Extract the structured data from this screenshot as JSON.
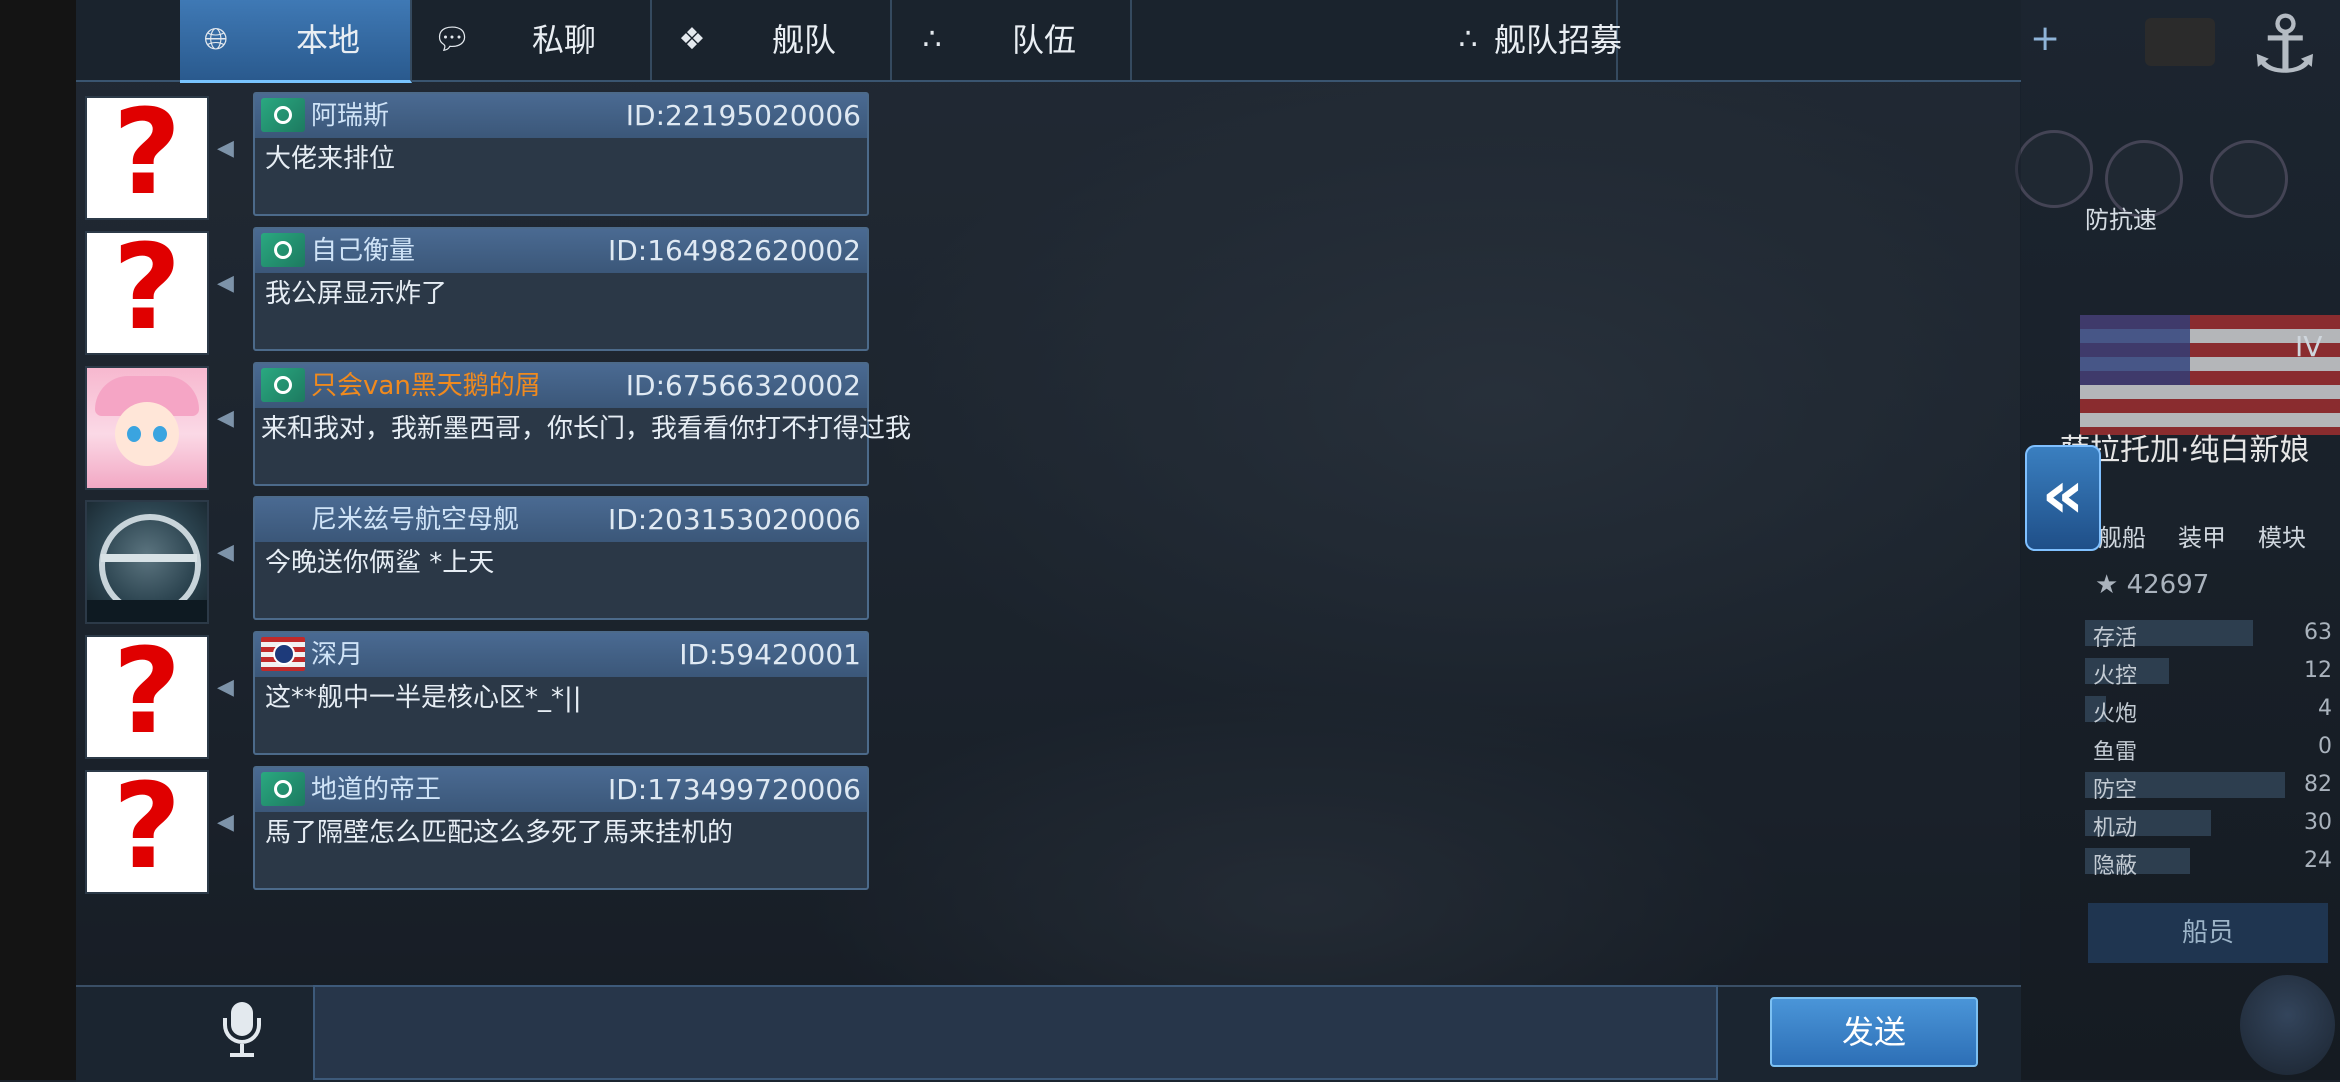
{
  "tabs": [
    {
      "label": "本地",
      "icon": "globe-icon",
      "active": true
    },
    {
      "label": "私聊",
      "icon": "chat-bubbles-icon",
      "active": false
    },
    {
      "label": "舰队",
      "icon": "fleet-emblem-icon",
      "active": false
    },
    {
      "label": "队伍",
      "icon": "team-dots-icon",
      "active": false
    },
    {
      "label": "舰队招募",
      "icon": "team-dots-icon",
      "active": false
    }
  ],
  "messages": [
    {
      "name": "阿瑞斯",
      "id": "ID:22195020006",
      "text": "大佬来排位",
      "avatar": "missing",
      "flag": "green",
      "name_color": "#cfe3f7"
    },
    {
      "name": "自己衡量",
      "id": "ID:164982620002",
      "text": "我公屏显示炸了",
      "avatar": "missing",
      "flag": "green",
      "name_color": "#cfe3f7"
    },
    {
      "name": "只会van黑天鹅的屑",
      "id": "ID:67566320002",
      "text": "来和我对，我新墨西哥，你长门，我看看你打不打得过我",
      "avatar": "anime-girl",
      "flag": "green",
      "name_color": "#f08a1e"
    },
    {
      "name": "尼米兹号航空母舰",
      "id": "ID:203153020006",
      "text": "今晚送你俩鲨 *上天",
      "avatar": "emblem",
      "flag": "none",
      "name_color": "#cfe3f7"
    },
    {
      "name": "深月",
      "id": "ID:59420001",
      "text": "这**舰中一半是核心区*_*||",
      "avatar": "missing",
      "flag": "us",
      "name_color": "#cfe3f7"
    },
    {
      "name": "地道的帝王",
      "id": "ID:173499720006",
      "text": "馬了隔壁怎么匹配这么多死了馬来挂机的",
      "avatar": "missing",
      "flag": "green",
      "name_color": "#cfe3f7"
    }
  ],
  "input": {
    "value": "",
    "send_label": "发送"
  },
  "right_panel": {
    "tier": "IV",
    "ship_name": "萨拉托加·纯白新娘",
    "label_aa": "防抗速",
    "tabs": [
      "舰船",
      "装甲",
      "模块"
    ],
    "score": "42697",
    "stats": [
      {
        "name": "存活",
        "value": "63",
        "level": 0.8
      },
      {
        "name": "火控",
        "value": "12",
        "level": 0.4
      },
      {
        "name": "火炮",
        "value": "4",
        "level": 0.1
      },
      {
        "name": "鱼雷",
        "value": "0",
        "level": 0.0
      },
      {
        "name": "防空",
        "value": "82",
        "level": 0.95
      },
      {
        "name": "机动",
        "value": "30",
        "level": 0.6
      },
      {
        "name": "隐蔽",
        "value": "24",
        "level": 0.5
      }
    ],
    "crew_label": "船员"
  },
  "colors": {
    "accent": "#3f79b5",
    "name_orange": "#f08a1e",
    "missing_avatar": "#e00000"
  }
}
